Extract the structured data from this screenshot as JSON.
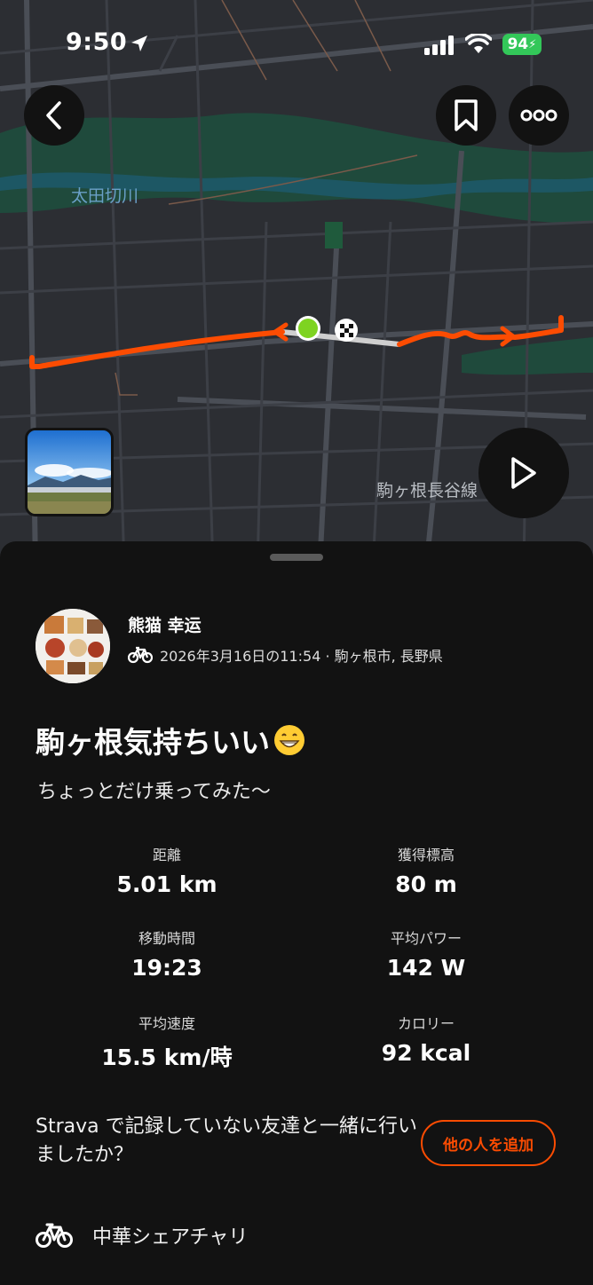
{
  "status_bar": {
    "time": "9:50",
    "battery": "94"
  },
  "map": {
    "river_label": "太田切川",
    "road_label": "駒ヶ根長谷線",
    "route_color": "#fc4c02",
    "start_marker_color": "#7ed321"
  },
  "icons": {
    "back": "back-arrow-icon",
    "bookmark": "bookmark-icon",
    "more": "more-options-icon",
    "play": "play-icon",
    "bike": "bike-icon"
  },
  "activity": {
    "athlete_name": "熊猫 幸运",
    "meta": "2026年3月16日の11:54 · 駒ヶ根市, 長野県",
    "title": "駒ヶ根気持ちいい",
    "description": "ちょっとだけ乗ってみた〜"
  },
  "stats": [
    {
      "label": "距離",
      "value": "5.01 km"
    },
    {
      "label": "獲得標高",
      "value": "80 m"
    },
    {
      "label": "移動時間",
      "value": "19:23"
    },
    {
      "label": "平均パワー",
      "value": "142 W"
    },
    {
      "label": "平均速度",
      "value": "15.5 km/時"
    },
    {
      "label": "カロリー",
      "value": "92 kcal"
    }
  ],
  "friends": {
    "prompt": "Strava で記録していない友達と一緒に行いましたか？",
    "button_label": "他の人を追加"
  },
  "gear": {
    "name": "中華シェアチャリ"
  },
  "colors": {
    "accent": "#fc4c02",
    "battery": "#33c759",
    "background": "#121212"
  }
}
